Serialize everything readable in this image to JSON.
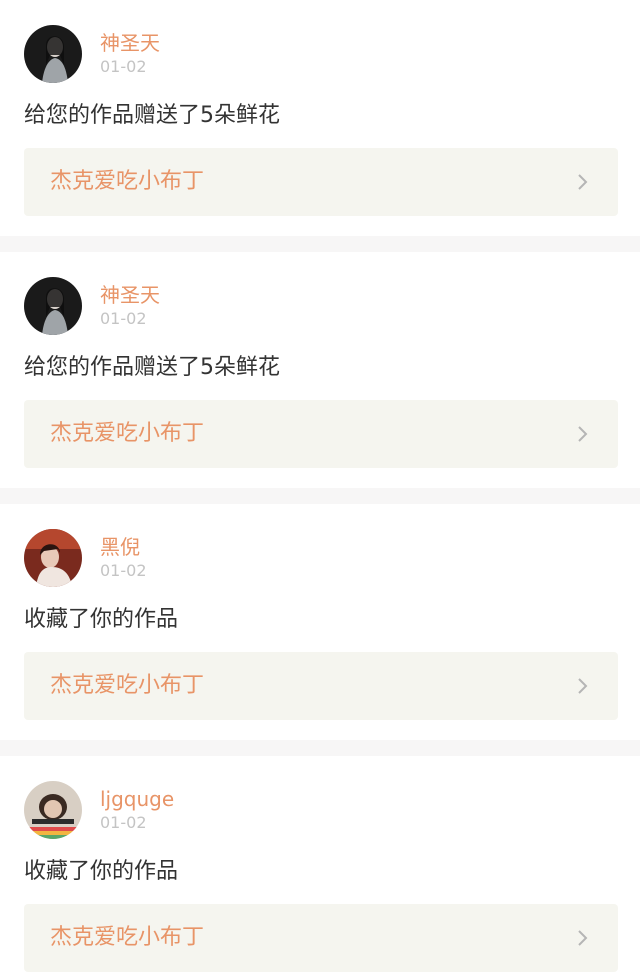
{
  "notifications": [
    {
      "username": "神圣天",
      "date": "01-02",
      "action": "给您的作品赠送了5朵鲜花",
      "work_title": "杰克爱吃小布丁",
      "avatar_icon": "user-avatar-dark-hair"
    },
    {
      "username": "神圣天",
      "date": "01-02",
      "action": "给您的作品赠送了5朵鲜花",
      "work_title": "杰克爱吃小布丁",
      "avatar_icon": "user-avatar-dark-hair"
    },
    {
      "username": "黑倪",
      "date": "01-02",
      "action": "收藏了你的作品",
      "work_title": "杰克爱吃小布丁",
      "avatar_icon": "user-avatar-red-portrait"
    },
    {
      "username": "ljgquge",
      "date": "01-02",
      "action": "收藏了你的作品",
      "work_title": "杰克爱吃小布丁",
      "avatar_icon": "user-avatar-colorful"
    }
  ],
  "colors": {
    "accent": "#e89467",
    "muted": "#c4c4c4",
    "text": "#333333",
    "work_bg": "#f5f5ef",
    "divider": "#f7f6f6"
  }
}
